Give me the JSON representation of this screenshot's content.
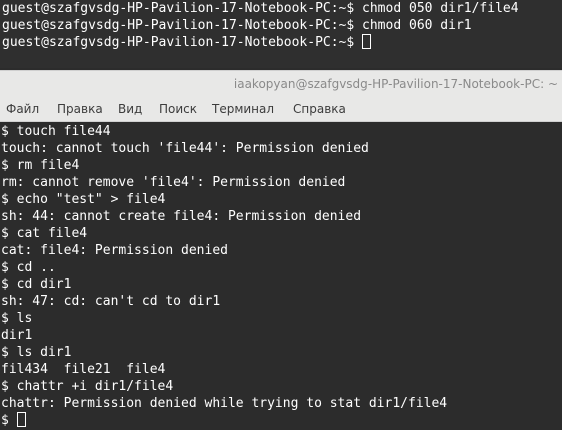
{
  "background_terminal": {
    "lines": [
      "guest@szafgvsdg-HP-Pavilion-17-Notebook-PC:~$ chmod 050 dir1/file4",
      "guest@szafgvsdg-HP-Pavilion-17-Notebook-PC:~$ chmod 060 dir1",
      "guest@szafgvsdg-HP-Pavilion-17-Notebook-PC:~$ "
    ]
  },
  "window": {
    "title": "iaakopyan@szafgvsdg-HP-Pavilion-17-Notebook-PC: ~",
    "menu": [
      "Файл",
      "Правка",
      "Вид",
      "Поиск",
      "Терминал",
      "Справка"
    ]
  },
  "terminal": {
    "lines": [
      "$ touch file44",
      "touch: cannot touch 'file44': Permission denied",
      "$ rm file4",
      "rm: cannot remove 'file4': Permission denied",
      "$ echo \"test\" > file4",
      "sh: 44: cannot create file4: Permission denied",
      "$ cat file4",
      "cat: file4: Permission denied",
      "$ cd ..",
      "$ cd dir1",
      "sh: 47: cd: can't cd to dir1",
      "$ ls",
      "dir1",
      "$ ls dir1",
      "fil434  file21  file4",
      "$ chattr +i dir1/file4",
      "chattr: Permission denied while trying to stat dir1/file4",
      "$ "
    ]
  },
  "colors": {
    "terminal_bg": "#2c2c2c",
    "text": "#ffffff",
    "chrome": "#e8e8e7"
  }
}
